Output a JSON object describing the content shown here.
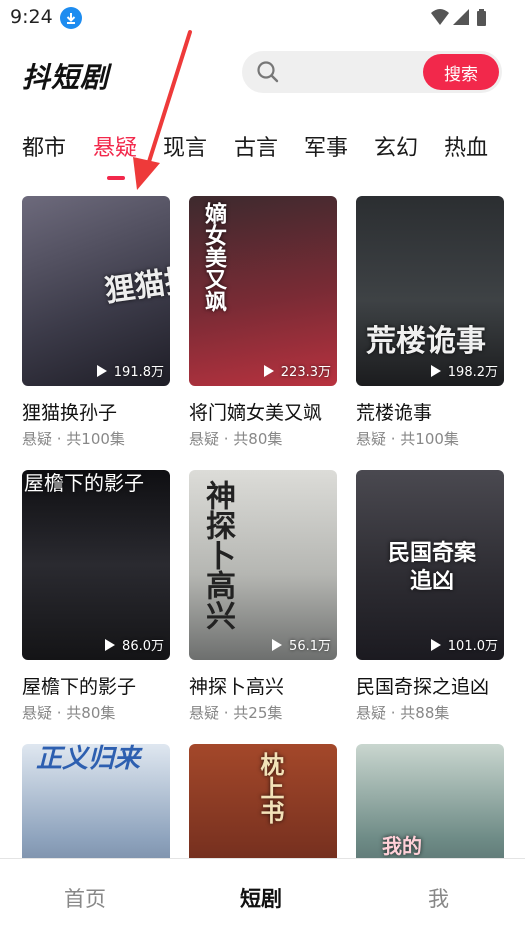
{
  "status_bar": {
    "time": "9:24",
    "icons": [
      "download-icon",
      "wifi-icon",
      "signal-icon",
      "battery-icon"
    ]
  },
  "header": {
    "app_title": "抖短剧",
    "search_placeholder": "",
    "search_button": "搜索"
  },
  "tabs": {
    "items": [
      "都市",
      "悬疑",
      "现言",
      "古言",
      "军事",
      "玄幻",
      "热血"
    ],
    "active": "悬疑"
  },
  "cards": [
    {
      "title": "狸猫换孙子",
      "meta": "悬疑 · 共100集",
      "views": "191.8万",
      "poster_text": "狸猫换孙子",
      "color": "#5a5668"
    },
    {
      "title": "将门嫡女美又飒",
      "meta": "悬疑 · 共80集",
      "views": "223.3万",
      "poster_text": "嫡女美又飒",
      "color": "#6a2530"
    },
    {
      "title": "荒楼诡事",
      "meta": "悬疑 · 共100集",
      "views": "198.2万",
      "poster_text": "荒楼诡事",
      "color": "#2d3436"
    },
    {
      "title": "屋檐下的影子",
      "meta": "悬疑 · 共80集",
      "views": "86.0万",
      "poster_text": "屋檐下的影子",
      "color": "#1f1f24"
    },
    {
      "title": "神探卜高兴",
      "meta": "悬疑 · 共25集",
      "views": "56.1万",
      "poster_text": "神探卜高兴",
      "color": "#b9b9b4"
    },
    {
      "title": "民国奇探之追凶",
      "meta": "悬疑 · 共88集",
      "views": "101.0万",
      "poster_text": "民国奇案追凶",
      "color": "#3b3a3f"
    },
    {
      "title": "",
      "meta": "",
      "views": "",
      "poster_text": "正义归来",
      "color": "#6f86a7"
    },
    {
      "title": "",
      "meta": "",
      "views": "",
      "poster_text": "枕上书",
      "color": "#8a3b22"
    },
    {
      "title": "",
      "meta": "",
      "views": "",
      "poster_text": "我的",
      "color": "#3c5a5a"
    }
  ],
  "bottom_nav": {
    "items": [
      "首页",
      "短剧",
      "我"
    ],
    "active": "短剧"
  },
  "colors": {
    "accent": "#f2284b",
    "text_secondary": "#888888"
  }
}
